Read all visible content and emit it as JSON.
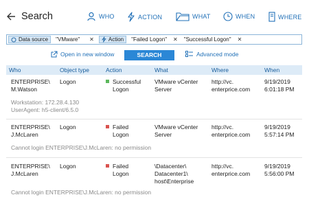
{
  "header": {
    "title": "Search",
    "nav": [
      {
        "label": "WHO",
        "icon": "user-icon"
      },
      {
        "label": "ACTION",
        "icon": "lightning-icon"
      },
      {
        "label": "WHAT",
        "icon": "folder-icon"
      },
      {
        "label": "WHEN",
        "icon": "clock-icon"
      },
      {
        "label": "WHERE",
        "icon": "server-icon"
      }
    ]
  },
  "filters": [
    {
      "label": "Data source",
      "icon": "data-source-icon",
      "values": [
        "\"VMware\""
      ]
    },
    {
      "label": "Action",
      "icon": "lightning-icon",
      "values": [
        "\"Failed Logon\"",
        "\"Successful Logon\""
      ]
    }
  ],
  "toolbar": {
    "open_window": "Open in new window",
    "search": "SEARCH",
    "advanced": "Advanced mode"
  },
  "table": {
    "columns": [
      "Who",
      "Object type",
      "Action",
      "What",
      "Where",
      "When"
    ],
    "rows": [
      {
        "who": [
          "ENTERPRISE\\",
          "M.Watson"
        ],
        "object_type": "Logon",
        "action": [
          "Successful",
          "Logon"
        ],
        "action_status": "success",
        "what": [
          "VMware vCenter",
          "Server"
        ],
        "where": [
          "http://vc.",
          "enterprice.com"
        ],
        "when": [
          "9/19/2019",
          "6:01:18 PM"
        ],
        "details": [
          "Workstation: 172.28.4.130",
          "UserAgent: h5-client/6.5.0"
        ]
      },
      {
        "who": [
          "ENTERPRISE\\",
          "J.McLaren"
        ],
        "object_type": "Logon",
        "action": [
          "Failed",
          "Logon"
        ],
        "action_status": "failed",
        "what": [
          "VMware vCenter",
          "Server"
        ],
        "where": [
          "http://vc.",
          "enterprice.com"
        ],
        "when": [
          "9/19/2019",
          "5:57:14 PM"
        ],
        "details": [
          "Cannot login ENTERPRISE\\J.McLaren: no permission"
        ]
      },
      {
        "who": [
          "ENTERPRISE\\",
          "J.McLaren"
        ],
        "object_type": "Logon",
        "action": [
          "Failed",
          "Logon"
        ],
        "action_status": "failed",
        "what": [
          "\\Datacenter\\",
          "Datacenter1\\",
          "host\\Enterprise"
        ],
        "where": [
          "http://vc.",
          "enterprice.com"
        ],
        "when": [
          "9/19/2019",
          "5:56:00 PM"
        ],
        "details": [
          "Cannot login ENTERPRISE\\J.McLaren: no permission"
        ]
      }
    ]
  },
  "colors": {
    "success": "#5cb85c",
    "failed": "#d9534f",
    "accent": "#2b87d6",
    "link": "#1f6fb7",
    "header_bg": "#ddebf7"
  }
}
